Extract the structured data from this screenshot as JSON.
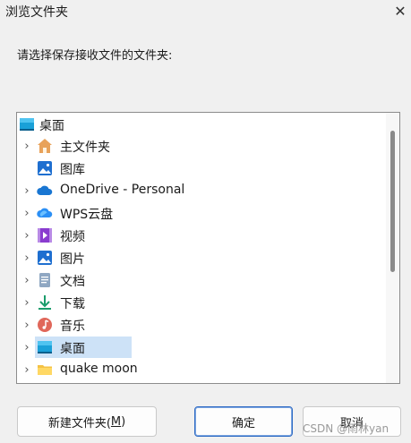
{
  "window": {
    "title": "浏览文件夹"
  },
  "prompt": "请选择保存接收文件的文件夹:",
  "tree": {
    "root": {
      "label": "桌面",
      "icon": "desktop-icon"
    },
    "items": [
      {
        "label": "主文件夹",
        "icon": "home-icon",
        "expandable": true
      },
      {
        "label": "图库",
        "icon": "gallery-icon",
        "expandable": false
      },
      {
        "label": "OneDrive - Personal",
        "icon": "cloud-icon",
        "expandable": true
      },
      {
        "label": "WPS云盘",
        "icon": "wps-cloud-icon",
        "expandable": true
      },
      {
        "label": "视频",
        "icon": "video-icon",
        "expandable": true
      },
      {
        "label": "图片",
        "icon": "pictures-icon",
        "expandable": true
      },
      {
        "label": "文档",
        "icon": "document-icon",
        "expandable": true
      },
      {
        "label": "下载",
        "icon": "download-icon",
        "expandable": true
      },
      {
        "label": "音乐",
        "icon": "music-icon",
        "expandable": true
      },
      {
        "label": "桌面",
        "icon": "desktop-icon",
        "expandable": true,
        "selected": true
      },
      {
        "label": "quake moon",
        "icon": "folder-icon",
        "expandable": true
      }
    ]
  },
  "buttons": {
    "new_folder_prefix": "新建文件夹(",
    "new_folder_key": "M",
    "new_folder_suffix": ")",
    "ok": "确定",
    "cancel": "取消"
  },
  "watermark": "CSDN @雨林yan",
  "colors": {
    "accent": "#2f6bc4",
    "selection": "#cde2f7",
    "background": "#f0f0f0"
  }
}
